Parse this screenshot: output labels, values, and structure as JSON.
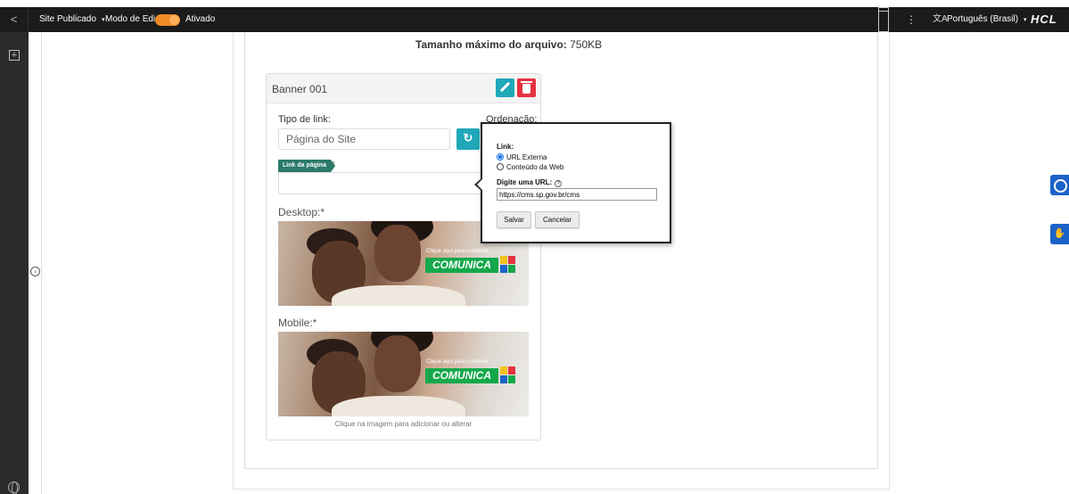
{
  "toolbar": {
    "back": "<",
    "site_status": "Site Publicado",
    "edit_mode_label": "Modo de Edição:",
    "edit_mode_state": "Ativado",
    "more": "⋮",
    "lang_symbol": "文A",
    "language": "Português (Brasil)",
    "logo": "HCL",
    "caret": "▾",
    "accent": "#f08a24"
  },
  "rail": {
    "add": "+",
    "expand": "›"
  },
  "content": {
    "file_size_label": "Tamanho máximo do arquivo:",
    "file_size_value": "750KB"
  },
  "banner": {
    "title": "Banner 001",
    "link_type_label": "Tipo de link:",
    "link_type_value": "Página do Site",
    "order_label": "Ordenação:",
    "refresh": "↻",
    "page_link_badge": "Link da página",
    "page_link_required": "*",
    "desktop_label": "Desktop:*",
    "mobile_label": "Mobile:*",
    "promo_small": "Clique aqui para conhecer",
    "promo_big": "COMUNICA",
    "hint": "Clique na imagem para adicionar ou alterar",
    "edit_color": "#20a8b8",
    "delete_color": "#e53140"
  },
  "popup": {
    "title": "Link:",
    "option_external": "URL Externa",
    "option_web": "Conteúdo da Web",
    "url_label": "Digite uma URL:",
    "help": "?",
    "url_value": "https://cms.sp.gov.br/cms",
    "save": "Salvar",
    "cancel": "Cancelar"
  },
  "side": {
    "libras": "✋"
  }
}
